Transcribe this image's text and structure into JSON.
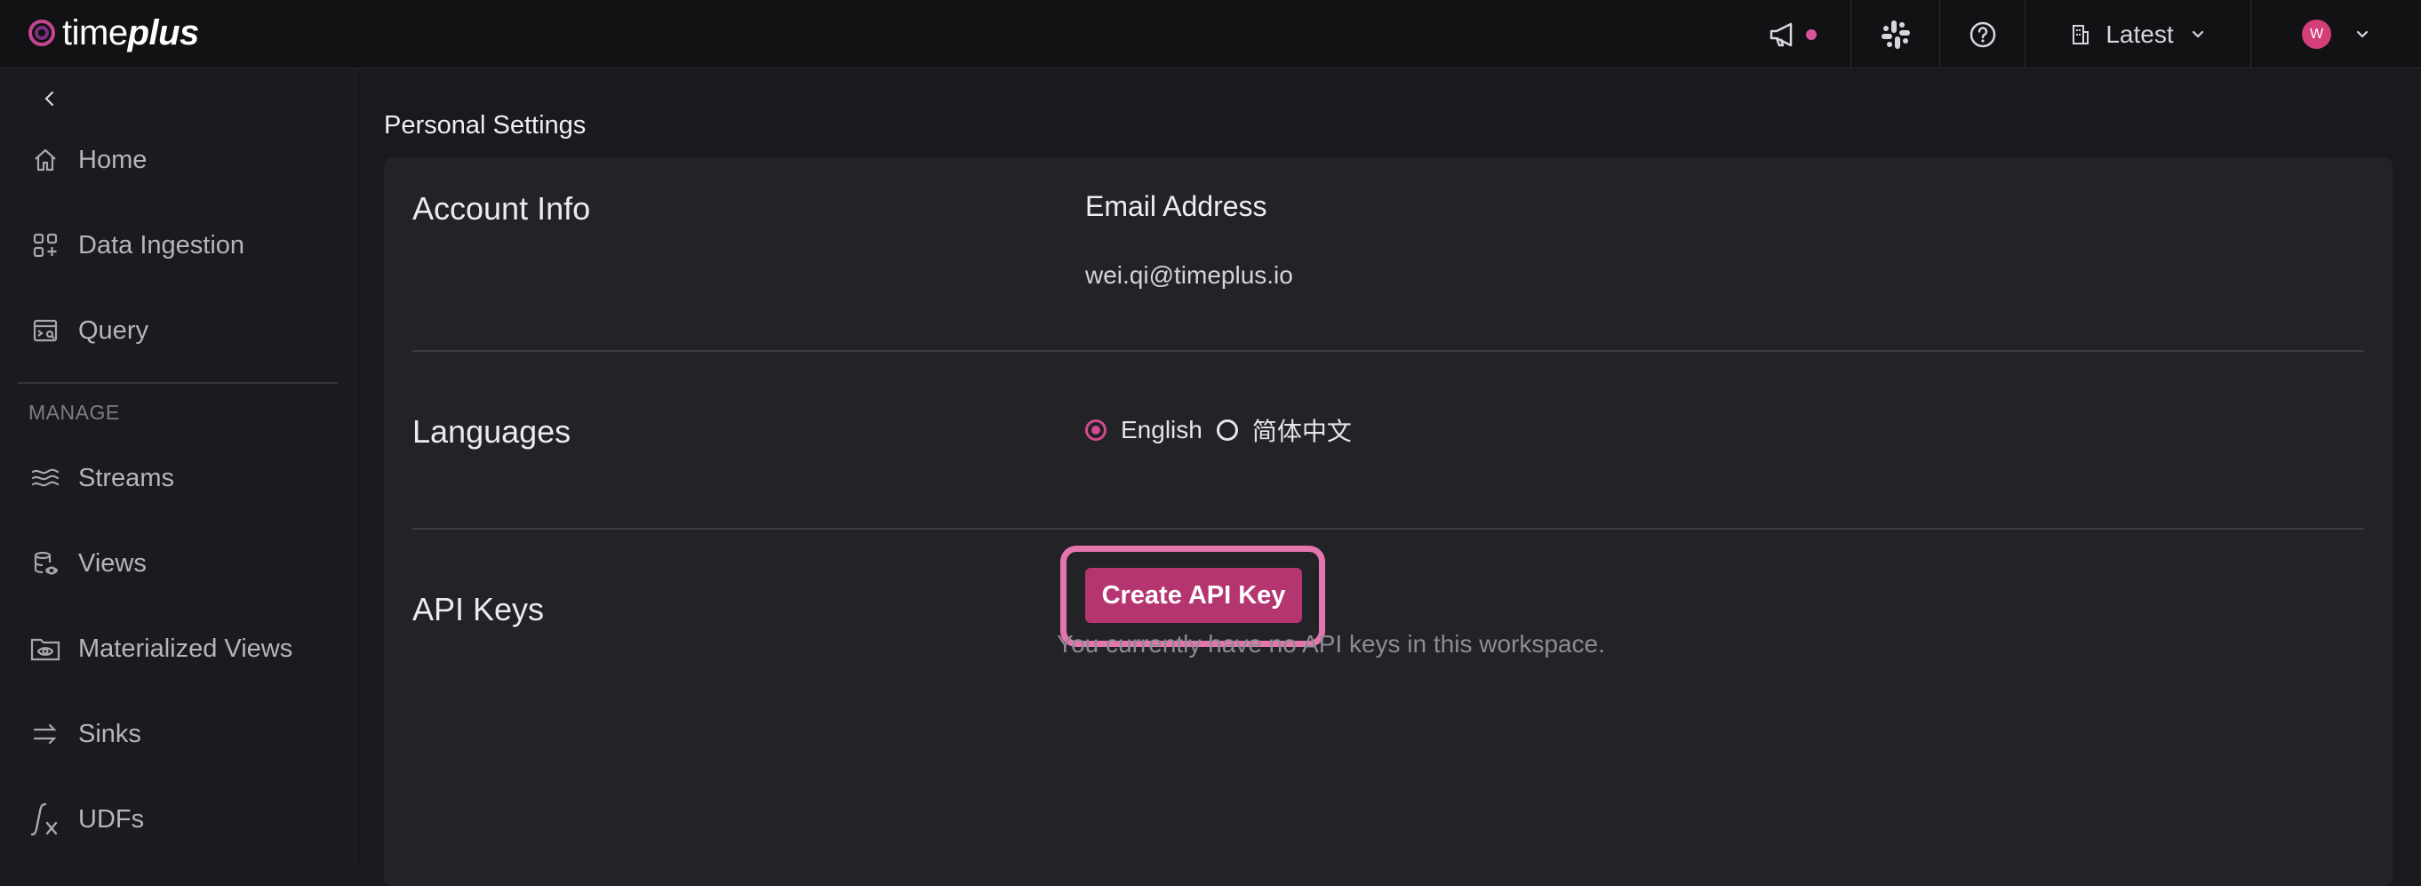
{
  "brand": {
    "prefix": "time",
    "suffix": "plus"
  },
  "topbar": {
    "workspace_label": "Latest",
    "user_initial": "W",
    "accent": "#d9559b"
  },
  "sidebar": {
    "main_items": [
      {
        "label": "Home",
        "icon": "home-icon"
      },
      {
        "label": "Data Ingestion",
        "icon": "data-ingestion-icon"
      },
      {
        "label": "Query",
        "icon": "query-icon"
      }
    ],
    "manage_label": "MANAGE",
    "manage_items": [
      {
        "label": "Streams",
        "icon": "streams-icon"
      },
      {
        "label": "Views",
        "icon": "views-icon"
      },
      {
        "label": "Materialized Views",
        "icon": "materialized-views-icon"
      },
      {
        "label": "Sinks",
        "icon": "sinks-icon"
      },
      {
        "label": "UDFs",
        "icon": "udf-icon"
      }
    ]
  },
  "page": {
    "title": "Personal Settings",
    "account": {
      "title": "Account Info",
      "email_label": "Email Address",
      "email_value": "wei.qi@timeplus.io"
    },
    "languages": {
      "title": "Languages",
      "options": [
        "English",
        "简体中文"
      ],
      "selected": "English"
    },
    "api_keys": {
      "title": "API Keys",
      "create_button": "Create API Key",
      "empty_note": "You currently have no API keys in this workspace."
    }
  }
}
